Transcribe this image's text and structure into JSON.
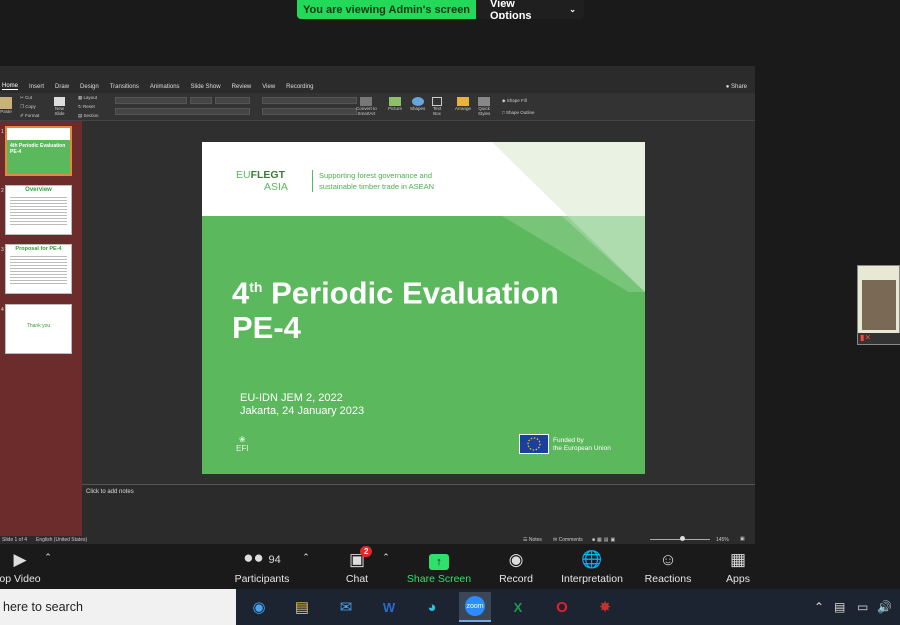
{
  "banner": {
    "viewing": "You are viewing Admin's screen",
    "view_options": "View Options"
  },
  "ppt": {
    "tabs": [
      "Home",
      "Insert",
      "Draw",
      "Design",
      "Transitions",
      "Animations",
      "Slide Show",
      "Review",
      "View",
      "Recording"
    ],
    "share": "Share",
    "clipboard": {
      "paste": "Paste",
      "cut": "Cut",
      "copy": "Copy",
      "format": "Format"
    },
    "slides_group": {
      "new_slide": "New\nSlide",
      "layout": "Layout",
      "reset": "Reset",
      "section": "Section"
    },
    "insert_group": {
      "convert": "Convert to\nSmartArt",
      "picture": "Picture",
      "shapes": "Shapes",
      "text_box": "Text\nBox",
      "arrange": "Arrange",
      "quick_styles": "Quick\nStyles",
      "shape_fill": "Shape Fill",
      "shape_outline": "Shape Outline"
    },
    "ruler_ticks": [
      "13",
      "12",
      "11",
      "10",
      "9",
      "8",
      "7",
      "6",
      "5",
      "4",
      "3",
      "2",
      "1",
      "0",
      "1",
      "2",
      "3",
      "4",
      "5",
      "6",
      "7",
      "8",
      "9",
      "10",
      "11",
      "12"
    ],
    "thumbnails": [
      {
        "num": "1",
        "title": "4th Periodic Evaluation PE-4"
      },
      {
        "num": "2",
        "title": "Overview"
      },
      {
        "num": "3",
        "title": "Proposal for PE-4"
      },
      {
        "num": "4",
        "title": "Thank you"
      }
    ],
    "slide": {
      "logo_eu": "EU",
      "logo_flegt": "FLEGT",
      "logo_asia": "ASIA",
      "tagline_1": "Supporting forest governance and",
      "tagline_2": "sustainable timber trade in ASEAN",
      "title_prefix": "4",
      "title_sup": "th",
      "title_rest": " Periodic Evaluation",
      "title_line2": "PE-4",
      "event": "EU-IDN JEM 2, 2022",
      "date": "Jakarta, 24 January 2023",
      "efi": "EFI",
      "funded_1": "Funded by",
      "funded_2": "the European Union"
    },
    "notes_placeholder": "Click to add notes",
    "status": {
      "slide": "Slide 1 of 4",
      "language": "English (United States)",
      "notes": "Notes",
      "comments": "Comments",
      "zoom": "145%"
    }
  },
  "toolbar": {
    "stop_video": "op Video",
    "participants": "Participants",
    "participants_count": "94",
    "chat": "Chat",
    "chat_badge": "2",
    "share": "Share Screen",
    "record": "Record",
    "interpretation": "Interpretation",
    "reactions": "Reactions",
    "apps": "Apps"
  },
  "taskbar": {
    "search": "here to search"
  },
  "colors": {
    "slide_green": "#5cb85c",
    "share_green": "#2fe06a",
    "banner_green": "#23d959",
    "thumb_panel": "#6b2c2b"
  }
}
